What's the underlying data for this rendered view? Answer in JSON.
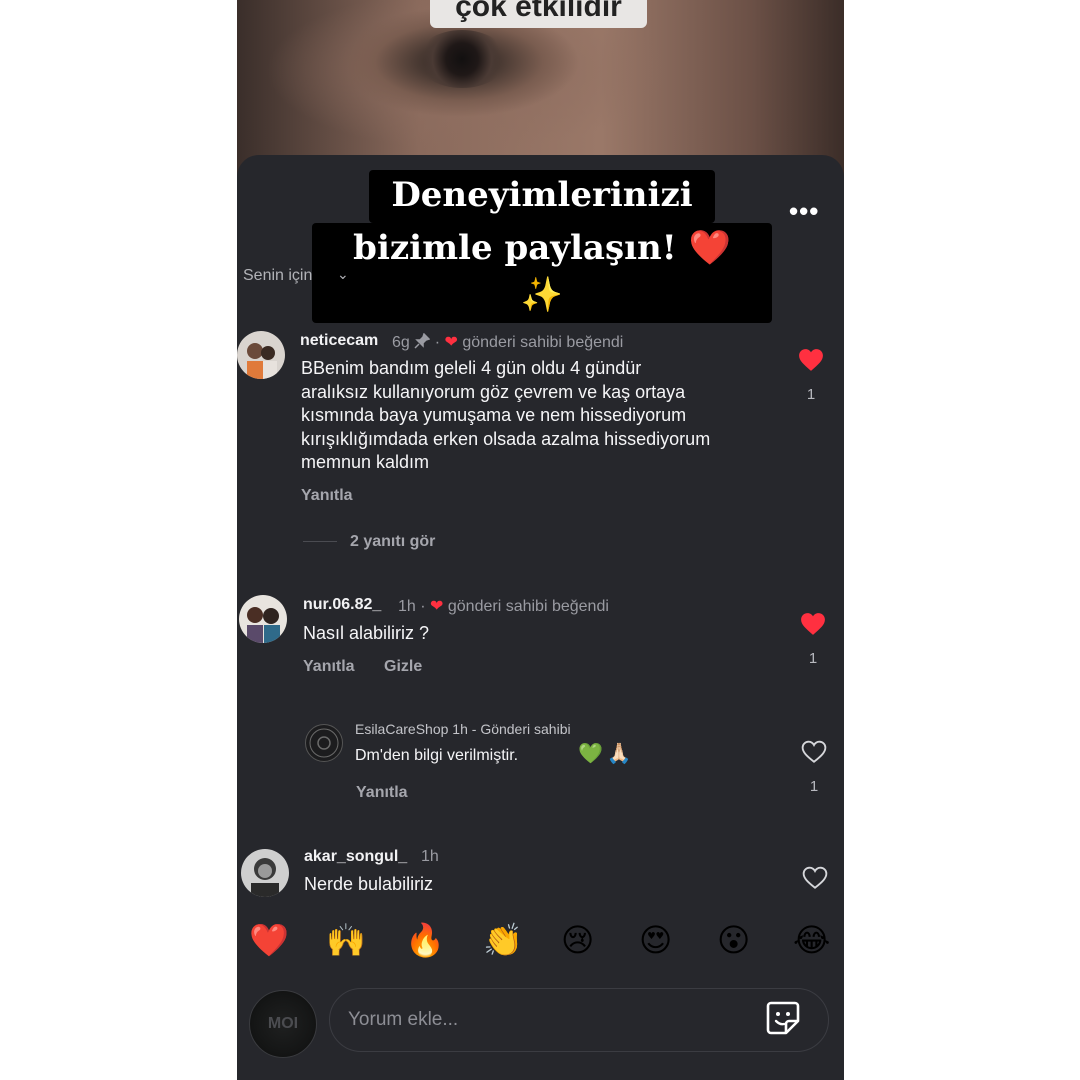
{
  "video": {
    "caption": "çok etkilidir"
  },
  "overlay": {
    "line1": "Deneyimlerinizi",
    "line2": "bizimle paylaşın! ❤️✨"
  },
  "header": {
    "more": "•••",
    "sort_label": "Senin için",
    "sort_icon": "chevron-down-icon"
  },
  "comments": [
    {
      "username": "neticecam",
      "time": "6g",
      "pinned": true,
      "liked_by_creator": "gönderi sahibi beğendi",
      "lines": [
        "BBenim bandım geleli 4 gün oldu 4 gündür",
        "aralıksız kullanıyorum göz çevrem ve kaş ortaya",
        "kısmında baya yumuşama ve nem hissediyorum",
        "kırışıklığımdada erken olsada azalma hissediyorum",
        "memnun kaldım"
      ],
      "reply": "Yanıtla",
      "likes": "1",
      "liked": true,
      "view_replies": "2 yanıtı gör"
    },
    {
      "username": "nur.06.82_",
      "time": "1h",
      "liked_by_creator": "gönderi sahibi beğendi",
      "text": "Nasıl alabiliriz ?",
      "reply": "Yanıtla",
      "hide": "Gizle",
      "likes": "1",
      "liked": true
    },
    {
      "username": "EsilaCareShop",
      "time": "1h",
      "role": "Gönderi sahibi",
      "text": "Dm'den bilgi verilmiştir.",
      "emojis": "💚🙏🏻",
      "reply": "Yanıtla",
      "likes": "1",
      "liked": false
    },
    {
      "username": "akar_songul_",
      "time": "1h",
      "text": "Nerde bulabiliriz",
      "liked": false
    }
  ],
  "emoji_bar": [
    "❤️",
    "🙌",
    "🔥",
    "👏",
    "😢",
    "😍",
    "😮",
    "😂"
  ],
  "composer": {
    "placeholder": "Yorum ekle...",
    "avatar_text": "MOI",
    "sticker_icon": "sticker-icon"
  },
  "colors": {
    "background": "#26272c",
    "like_red": "#ff3040",
    "text": "#f5f5f7",
    "muted": "#9a9ba2"
  }
}
